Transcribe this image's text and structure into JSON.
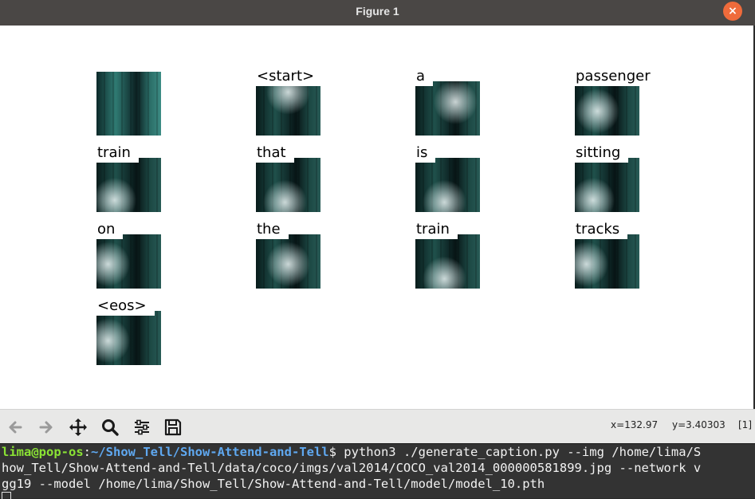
{
  "window": {
    "title": "Figure 1",
    "close_glyph": "×"
  },
  "figure": {
    "tiles": [
      {
        "word": "",
        "focus": "none"
      },
      {
        "word": "<start>",
        "focus": "top"
      },
      {
        "word": "a",
        "focus": "right"
      },
      {
        "word": "passenger",
        "focus": "center-left"
      },
      {
        "word": "train",
        "focus": "bottom-left"
      },
      {
        "word": "that",
        "focus": "bottom"
      },
      {
        "word": "is",
        "focus": "bottom"
      },
      {
        "word": "sitting",
        "focus": "bottom-left"
      },
      {
        "word": "on",
        "focus": "left"
      },
      {
        "word": "the",
        "focus": "center"
      },
      {
        "word": "train",
        "focus": "bottom"
      },
      {
        "word": "tracks",
        "focus": "left"
      },
      {
        "word": "<eos>",
        "focus": "left"
      }
    ]
  },
  "toolbar": {
    "buttons": [
      {
        "icon": "back-arrow-icon"
      },
      {
        "icon": "forward-arrow-icon"
      },
      {
        "icon": "pan-icon"
      },
      {
        "icon": "zoom-icon"
      },
      {
        "icon": "configure-subplots-icon"
      },
      {
        "icon": "save-icon"
      }
    ],
    "x_readout": "x=132.97",
    "y_readout": "y=3.40303",
    "index_readout": "[1]"
  },
  "terminal": {
    "user_host": "lima@pop-os",
    "colon": ":",
    "path": "~/Show_Tell/Show-Attend-and-Tell",
    "dollar": "$",
    "line1_cmd": " python3 ./generate_caption.py --img /home/lima/S",
    "line2": "how_Tell/Show-Attend-and-Tell/data/coco/imgs/val2014/COCO_val2014_000000581899.jpg --network v",
    "line3": "gg19 --model /home/lima/Show_Tell/Show-Attend-and-Tell/model/model_10.pth"
  },
  "colors": {
    "title_bar": "#4a4745",
    "close_button": "#ef6b3b",
    "train_teal": "#2f7a72",
    "prompt_user": "#8ae234",
    "prompt_path": "#5fa8f0"
  }
}
